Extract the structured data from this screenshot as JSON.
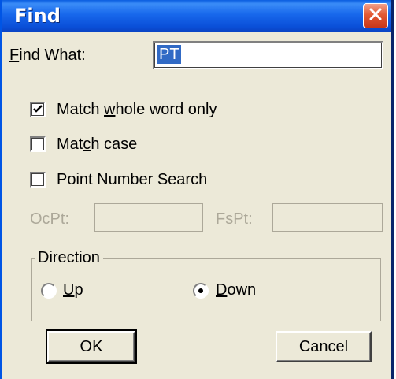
{
  "window": {
    "title": "Find"
  },
  "find": {
    "label_pre": "",
    "label_accel": "F",
    "label_post": "ind What:",
    "value": "PT"
  },
  "options": {
    "whole_word": {
      "pre": "Match ",
      "accel": "w",
      "post": "hole word only",
      "checked": true
    },
    "match_case": {
      "pre": "Mat",
      "accel": "c",
      "post": "h case",
      "checked": false
    },
    "point_number": {
      "pre": "Point Number Search",
      "accel": "",
      "post": "",
      "checked": false
    }
  },
  "points": {
    "ocpt_label": "OcPt:",
    "fspt_label": "FsPt:"
  },
  "direction": {
    "legend": "Direction",
    "up": {
      "pre": "",
      "accel": "U",
      "post": "p",
      "selected": false
    },
    "down": {
      "pre": "",
      "accel": "D",
      "post": "own",
      "selected": true
    }
  },
  "buttons": {
    "ok": "OK",
    "cancel": "Cancel"
  }
}
